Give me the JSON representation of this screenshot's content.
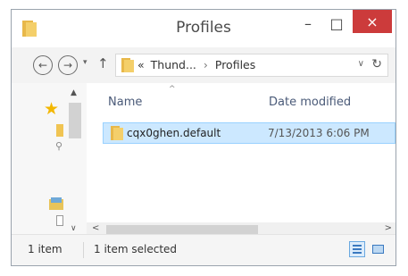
{
  "window": {
    "title": "Profiles",
    "minimize_glyph": "–",
    "maximize_glyph": "□",
    "close_glyph": "×",
    "close_color": "#cc3b3b"
  },
  "address_bar": {
    "back_glyph": "←",
    "forward_glyph": "→",
    "recent_glyph": "▾",
    "up_glyph": "↑",
    "overflow": "«",
    "breadcrumbs": [
      "Thund...",
      "Profiles"
    ],
    "separator": "›",
    "dropdown_glyph": "∨",
    "refresh_glyph": "↻"
  },
  "nav_pane": {
    "favorites_icon": "star-icon",
    "star_glyph": "★",
    "scroll_up_glyph": "▲",
    "scroll_down_glyph": "∨"
  },
  "file_list": {
    "columns": {
      "name": "Name",
      "date_modified": "Date modified"
    },
    "sort_glyph": "^",
    "items": [
      {
        "name": "cqx0ghen.default",
        "date_modified": "7/13/2013 6:06 PM",
        "selected": true
      }
    ],
    "selection_color": "#cce8ff"
  },
  "status_bar": {
    "item_count": "1 item",
    "selection": "1 item selected"
  },
  "scrollbar": {
    "left_glyph": "<",
    "right_glyph": ">"
  }
}
